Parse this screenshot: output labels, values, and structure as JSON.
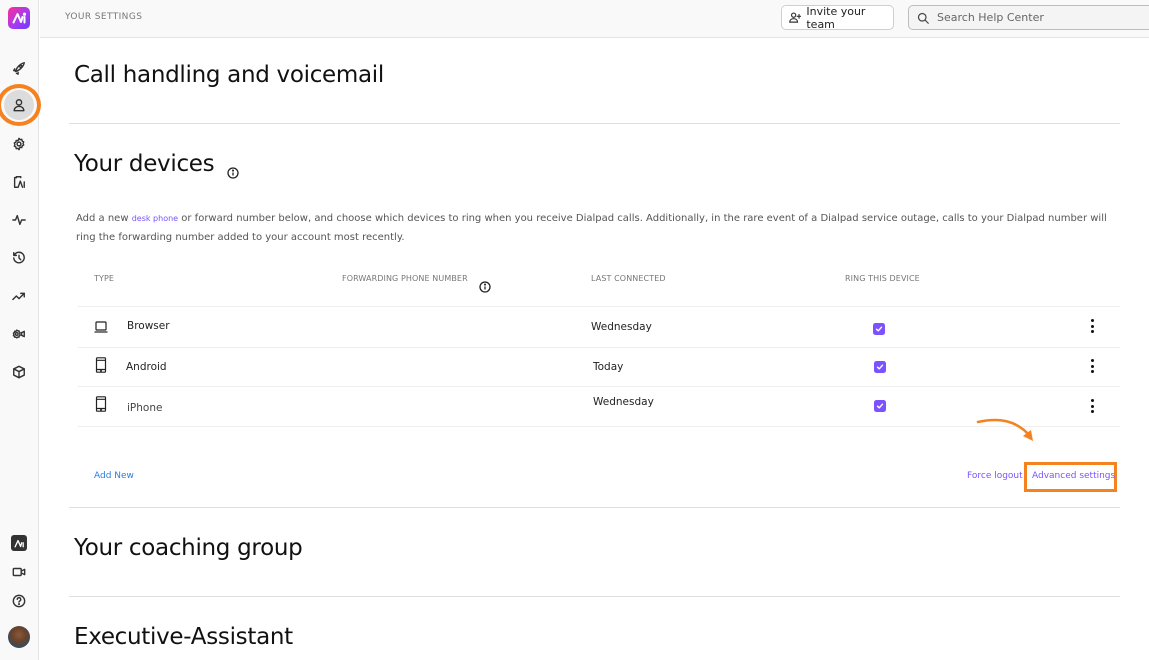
{
  "sidebar": {
    "logo": "dialpad-logo-icon",
    "items": [
      {
        "icon": "rocket-icon",
        "active": false
      },
      {
        "icon": "user-icon",
        "active": true
      },
      {
        "icon": "gear-icon",
        "active": false
      },
      {
        "icon": "clipboard-ai-icon",
        "active": false
      },
      {
        "icon": "pulse-icon",
        "active": false
      },
      {
        "icon": "history-icon",
        "active": false
      },
      {
        "icon": "trending-up-icon",
        "active": false
      },
      {
        "icon": "camera-settings-icon",
        "active": false
      },
      {
        "icon": "cube-icon",
        "active": false
      }
    ],
    "bottom_items": [
      {
        "icon": "dialpad-app-icon"
      },
      {
        "icon": "video-icon"
      },
      {
        "icon": "help-icon"
      },
      {
        "icon": "avatar"
      }
    ]
  },
  "topbar": {
    "breadcrumb": "YOUR SETTINGS",
    "invite_label": "Invite your team",
    "search_placeholder": "Search Help Center"
  },
  "sections": {
    "call_handling": "Call handling and voicemail",
    "devices": {
      "title": "Your devices",
      "desc_prefix": "Add a new ",
      "desc_link": "desk phone",
      "desc_suffix": " or forward number below, and choose which devices to ring when you receive Dialpad calls. Additionally, in the rare event of a Dialpad service outage, calls to your Dialpad number will ring the forwarding number added to your account most recently.",
      "columns": [
        "TYPE",
        "FORWARDING PHONE NUMBER",
        "LAST CONNECTED",
        "RING THIS DEVICE"
      ],
      "rows": [
        {
          "type": "Browser",
          "icon": "laptop-icon",
          "forwarding": "",
          "last_connected": "Wednesday",
          "ring": true
        },
        {
          "type": "Android",
          "icon": "mobile-phone-icon",
          "forwarding": "",
          "last_connected": "Today",
          "ring": true
        },
        {
          "type": "iPhone",
          "icon": "mobile-phone-icon",
          "forwarding": "",
          "last_connected": "Wednesday",
          "ring": true
        }
      ],
      "add_new": "Add New",
      "force_logout": "Force logout",
      "advanced_settings": "Advanced settings"
    },
    "coaching_group": "Your coaching group",
    "executive_assistant": "Executive-Assistant"
  },
  "colors": {
    "accent": "#7c52ff",
    "link_blue": "#2a7de1",
    "annotation_orange": "#f58220"
  }
}
